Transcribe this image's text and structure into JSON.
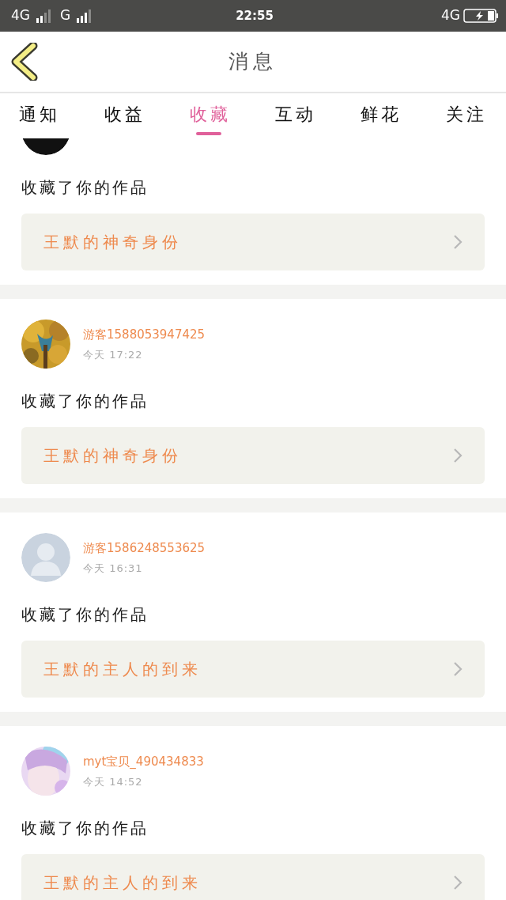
{
  "status_bar": {
    "carrier_1": "4G",
    "carrier_2": "G",
    "time": "22:55",
    "network": "4G"
  },
  "header": {
    "title": "消息"
  },
  "tabs": [
    {
      "label": "通知",
      "selected": false
    },
    {
      "label": "收益",
      "selected": false
    },
    {
      "label": "收藏",
      "selected": true
    },
    {
      "label": "互动",
      "selected": false
    },
    {
      "label": "鲜花",
      "selected": false
    },
    {
      "label": "关注",
      "selected": false
    }
  ],
  "messages": [
    {
      "action": "收藏了你的作品",
      "work": "王默的神奇身份"
    },
    {
      "name": "游客1588053947425",
      "time": "今天 17:22",
      "action": "收藏了你的作品",
      "work": "王默的神奇身份"
    },
    {
      "avatar": {
        "kind": "default"
      },
      "name": "游客1586248553625",
      "time": "今天 16:31",
      "action": "收藏了你的作品",
      "work": "王默的主人的到来"
    },
    {
      "name": "myt宝贝_490434833",
      "time": "今天 14:52",
      "action": "收藏了你的作品",
      "work": "王默的主人的到来"
    }
  ]
}
